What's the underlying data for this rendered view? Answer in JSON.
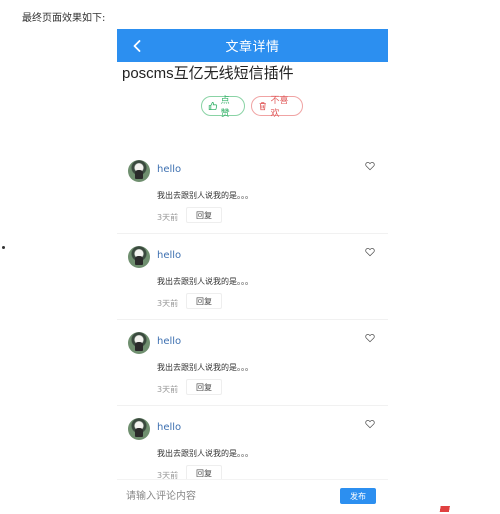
{
  "intro": "最终页面效果如下:",
  "header": {
    "back_icon": "chevron-left-icon",
    "title": "文章详情"
  },
  "article": {
    "title": "poscms互亿无线短信插件"
  },
  "actions": {
    "like_label": "点赞",
    "dislike_label": "不喜欢"
  },
  "comments": [
    {
      "name": "hello",
      "content": "我出去跟别人说我的是。。。",
      "time": "3天前",
      "reply_label": "回复"
    },
    {
      "name": "hello",
      "content": "我出去跟别人说我的是。。。",
      "time": "3天前",
      "reply_label": "回复"
    },
    {
      "name": "hello",
      "content": "我出去跟别人说我的是。。。",
      "time": "3天前",
      "reply_label": "回复"
    },
    {
      "name": "hello",
      "content": "我出去跟别人说我的是。。。",
      "time": "3天前",
      "reply_label": "回复"
    }
  ],
  "input": {
    "placeholder": "请输入评论内容",
    "value": "",
    "submit_label": "发布"
  },
  "colors": {
    "accent": "#2c8ff0",
    "like": "#36b26a",
    "dislike": "#e05a5a",
    "name": "#3c6fb0"
  }
}
